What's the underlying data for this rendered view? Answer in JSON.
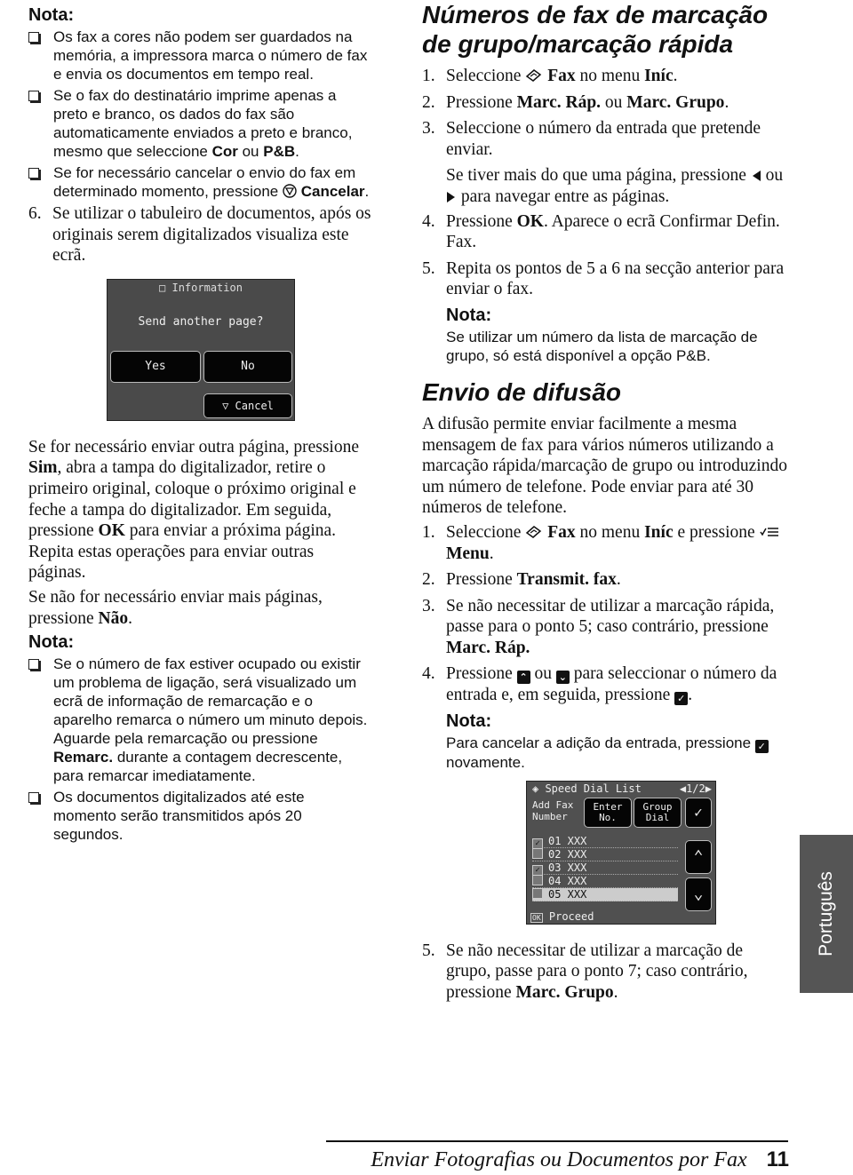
{
  "left": [
    {
      "k": "nt",
      "t": "Nota:"
    },
    {
      "k": "bl",
      "r": [
        {
          "t": "Os fax a cores não podem ser guardados na memória, a impressora marca o número de fax e envia os documentos em tempo real."
        }
      ]
    },
    {
      "k": "bl",
      "r": [
        {
          "t": "Se o fax do destinatário imprime apenas a preto e branco, os dados do fax são automaticamente enviados a preto e branco, mesmo que seleccione "
        },
        {
          "t": "Cor",
          "b": 1
        },
        {
          "t": " ou "
        },
        {
          "t": "P&B",
          "b": 1
        },
        {
          "t": "."
        }
      ]
    },
    {
      "k": "bl",
      "r": [
        {
          "t": "Se for necessário cancelar o envio do fax em determinado momento, pressione "
        },
        {
          "i": "stop-icon"
        },
        {
          "t": " Cancelar",
          "b": 1
        },
        {
          "t": "."
        }
      ]
    },
    {
      "k": "st",
      "n": "6.",
      "r": [
        {
          "t": "Se utilizar o tabuleiro de documentos, após os originais serem digitalizados visualiza este ecrã."
        }
      ]
    },
    {
      "k": "lcd1"
    },
    {
      "k": "p",
      "r": [
        {
          "t": "Se for necessário enviar outra página, pressione "
        },
        {
          "t": "Sim",
          "b": 1
        },
        {
          "t": ", abra a tampa do digitalizador, retire o primeiro original, coloque o próximo original e feche a tampa do digitalizador. Em seguida, pressione "
        },
        {
          "t": "OK",
          "b": 1
        },
        {
          "t": " para enviar a próxima página. Repita estas operações para enviar outras páginas."
        }
      ]
    },
    {
      "k": "p",
      "r": [
        {
          "t": "Se não for necessário enviar mais páginas, pressione "
        },
        {
          "t": "Não",
          "b": 1
        },
        {
          "t": "."
        }
      ]
    },
    {
      "k": "nt",
      "t": "Nota:"
    },
    {
      "k": "bl",
      "r": [
        {
          "t": "Se o número de fax estiver ocupado ou existir um problema de ligação, será visualizado um ecrã de informação de remarcação e o aparelho remarca o número um minuto depois. Aguarde pela remarcação ou pressione "
        },
        {
          "t": "Remarc.",
          "b": 1
        },
        {
          "t": " durante a contagem decrescente, para remarcar imediatamente."
        }
      ]
    },
    {
      "k": "bl",
      "r": [
        {
          "t": "Os documentos digitalizados até este momento serão transmitidos após 20 segundos."
        }
      ]
    }
  ],
  "right": [
    {
      "k": "h",
      "t": "Números de fax de marcação de grupo/marcação rápida"
    },
    {
      "k": "st",
      "n": "1.",
      "r": [
        {
          "t": "Seleccione "
        },
        {
          "i": "fax-icon"
        },
        {
          "t": " Fax",
          "b": 1
        },
        {
          "t": " no menu "
        },
        {
          "t": "Iníc",
          "b": 1
        },
        {
          "t": "."
        }
      ]
    },
    {
      "k": "st",
      "n": "2.",
      "r": [
        {
          "t": "Pressione "
        },
        {
          "t": "Marc. Ráp.",
          "b": 1
        },
        {
          "t": " ou "
        },
        {
          "t": "Marc. Grupo",
          "b": 1
        },
        {
          "t": "."
        }
      ]
    },
    {
      "k": "st",
      "n": "3.",
      "r": [
        {
          "t": "Seleccione o número da entrada que pretende enviar."
        }
      ]
    },
    {
      "k": "sub",
      "r": [
        {
          "t": "Se tiver mais do que uma página, pressione "
        },
        {
          "i": "left-arrow-icon"
        },
        {
          "t": " ou "
        },
        {
          "i": "right-arrow-icon"
        },
        {
          "t": " para navegar entre as páginas."
        }
      ]
    },
    {
      "k": "st",
      "n": "4.",
      "r": [
        {
          "t": "Pressione "
        },
        {
          "t": "OK",
          "b": 1
        },
        {
          "t": ". Aparece o ecrã Confirmar Defin. Fax."
        }
      ]
    },
    {
      "k": "st",
      "n": "5.",
      "r": [
        {
          "t": "Repita os pontos de 5 a 6 na secção anterior para enviar o fax."
        }
      ]
    },
    {
      "k": "nti",
      "t": "Nota:"
    },
    {
      "k": "npi",
      "r": [
        {
          "t": "Se utilizar um número da lista de marcação de grupo, só está disponível a opção P&B."
        }
      ]
    },
    {
      "k": "h",
      "t": "Envio de difusão"
    },
    {
      "k": "p",
      "r": [
        {
          "t": "A difusão permite enviar facilmente a mesma mensagem de fax para vários números utilizando a marcação rápida/marcação de grupo ou introduzindo um número de telefone. Pode enviar para até 30 números de telefone."
        }
      ]
    },
    {
      "k": "st",
      "n": "1.",
      "r": [
        {
          "t": "Seleccione "
        },
        {
          "i": "fax-icon"
        },
        {
          "t": " Fax",
          "b": 1
        },
        {
          "t": " no menu "
        },
        {
          "t": "Iníc",
          "b": 1
        },
        {
          "t": " e pressione "
        },
        {
          "i": "menu-icon"
        },
        {
          "t": " Menu",
          "b": 1
        },
        {
          "t": "."
        }
      ]
    },
    {
      "k": "st",
      "n": "2.",
      "r": [
        {
          "t": "Pressione "
        },
        {
          "t": "Transmit. fax",
          "b": 1
        },
        {
          "t": "."
        }
      ]
    },
    {
      "k": "st",
      "n": "3.",
      "r": [
        {
          "t": "Se não necessitar de utilizar a marcação rápida, passe para o ponto 5; caso contrário, pressione "
        },
        {
          "t": "Marc. Ráp.",
          "b": 1
        }
      ]
    },
    {
      "k": "st",
      "n": "4.",
      "r": [
        {
          "t": "Pressione "
        },
        {
          "i": "up-button-icon"
        },
        {
          "t": " ou "
        },
        {
          "i": "down-button-icon"
        },
        {
          "t": " para seleccionar o número da entrada e, em seguida, pressione "
        },
        {
          "i": "check-button-icon"
        },
        {
          "t": "."
        }
      ]
    },
    {
      "k": "nti",
      "t": "Nota:"
    },
    {
      "k": "npi",
      "r": [
        {
          "t": "Para cancelar a adição da entrada, pressione "
        },
        {
          "i": "check-button-icon"
        },
        {
          "t": " novamente."
        }
      ]
    },
    {
      "k": "lcd2"
    },
    {
      "k": "st",
      "n": "5.",
      "r": [
        {
          "t": "Se não necessitar de utilizar a marcação de grupo, passe para o ponto 7; caso contrário, pressione "
        },
        {
          "t": "Marc. Grupo",
          "b": 1
        },
        {
          "t": "."
        }
      ]
    }
  ],
  "lcd1": {
    "title": "Information",
    "message": "Send another page?",
    "yes": "Yes",
    "no": "No",
    "cancel": "Cancel"
  },
  "lcd2": {
    "title": "Speed Dial List",
    "page": "1/2",
    "add": "Add Fax Number",
    "enter": "Enter No.",
    "group": "Group Dial",
    "ok": "OK",
    "proceed": "Proceed",
    "rows": [
      {
        "label": "01 XXX",
        "checked": true
      },
      {
        "label": "02 XXX",
        "checked": false
      },
      {
        "label": "03 XXX",
        "checked": true
      },
      {
        "label": "04 XXX",
        "checked": false
      },
      {
        "label": "05 XXX",
        "checked": false,
        "selected": true
      }
    ]
  },
  "side_tab": "Português",
  "footer": {
    "title": "Enviar Fotografias ou Documentos por Fax",
    "page": "11"
  }
}
